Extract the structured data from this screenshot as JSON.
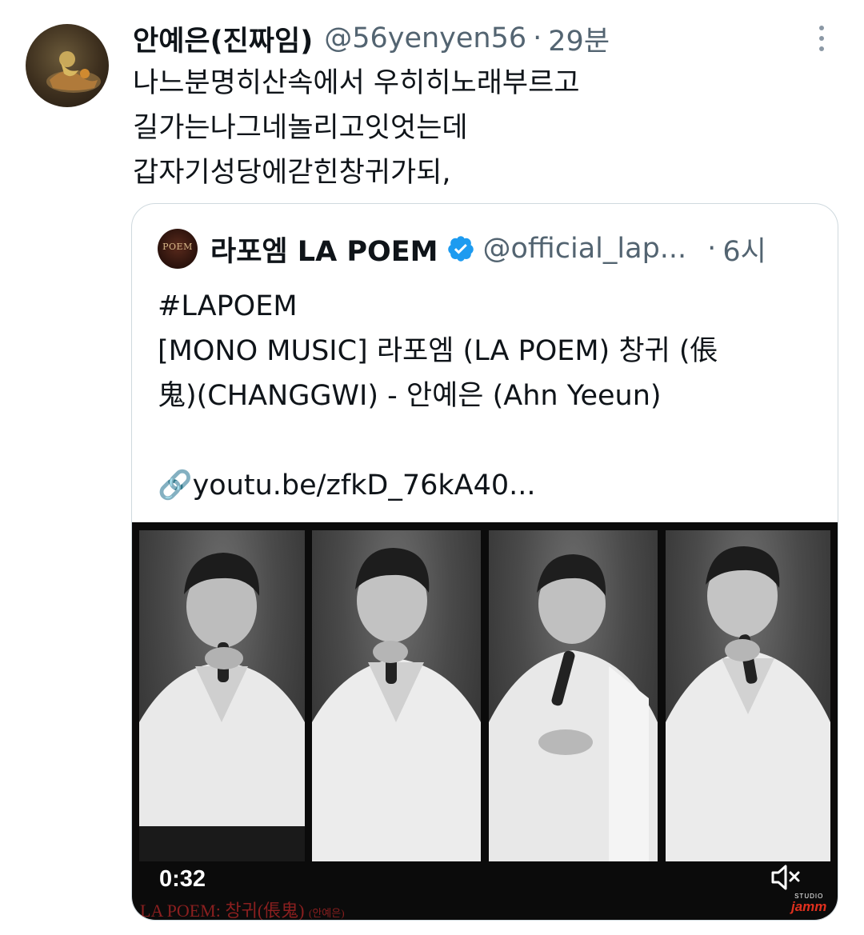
{
  "tweet": {
    "display_name": "안예은(진짜임)",
    "handle": "@56yenyen56",
    "separator": "·",
    "time": "29분",
    "lines": [
      "나느분명히산속에서 우히히노래부르고",
      "길가는나그네놀리고잇엇는데",
      "갑자기성당에갇힌창귀가되,"
    ]
  },
  "quote": {
    "display_name": "라포엠 LA POEM",
    "avatar_text": "POEM",
    "handle": "@official_lap...",
    "separator": "·",
    "time": "6시",
    "lines": [
      "#LAPOEM",
      "[MONO MUSIC] 라포엠 (LA POEM) 창귀 (倀",
      "鬼)(CHANGGWI) - 안예은 (Ahn Yeeun)",
      "",
      "🔗youtu.be/zfkD_76kA40..."
    ]
  },
  "video": {
    "duration": "0:32",
    "caption_main": "LA POEM: 창귀(倀鬼)",
    "caption_small": "(안예은)",
    "studio_small": "STUDIO",
    "studio_name": "jamm"
  },
  "colors": {
    "text": "#0f1419",
    "secondary": "#536471",
    "border": "#cfd9de",
    "verified": "#1d9bf0"
  },
  "icons": [
    "more-icon",
    "verified-badge-icon",
    "mute-icon",
    "link-icon"
  ]
}
